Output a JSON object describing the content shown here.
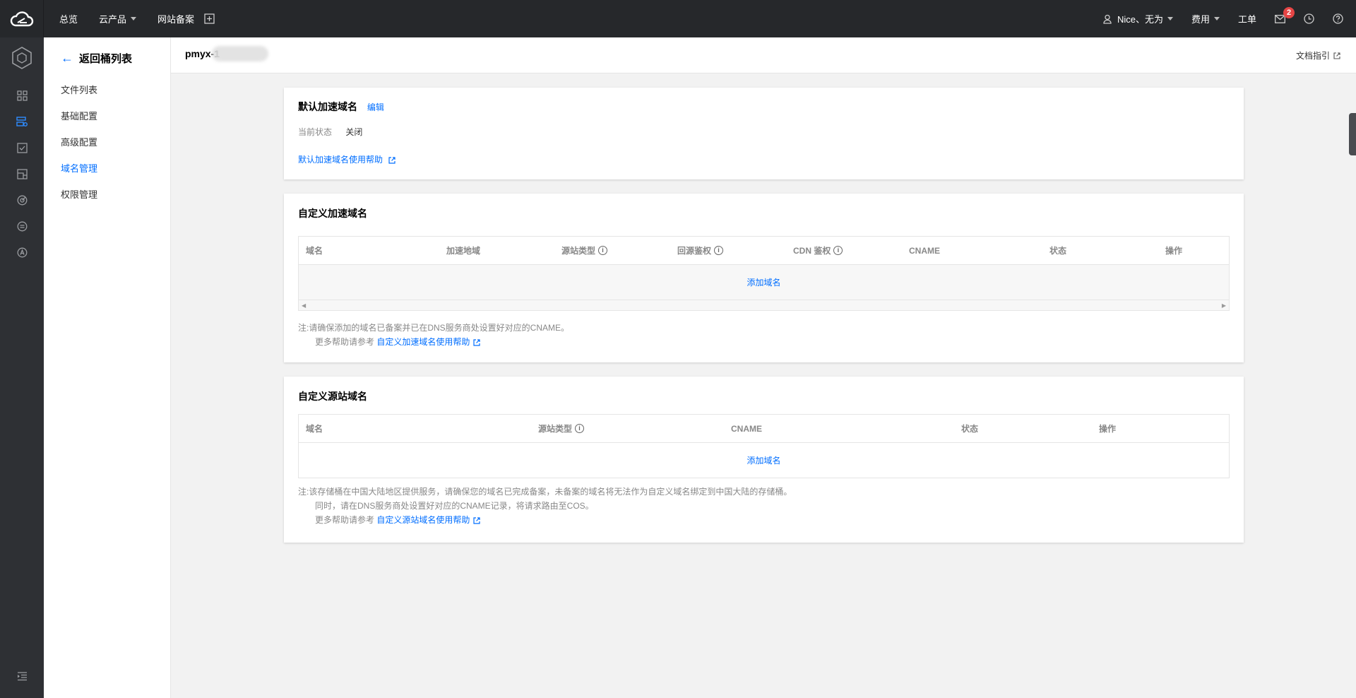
{
  "topbar": {
    "nav": [
      "总览",
      "云产品",
      "网站备案"
    ],
    "user": "Nice、无为",
    "fee": "费用",
    "ticket": "工单",
    "msg_count": "2"
  },
  "subside": {
    "back_label": "返回桶列表",
    "items": [
      "文件列表",
      "基础配置",
      "高级配置",
      "域名管理",
      "权限管理"
    ]
  },
  "header": {
    "bucket_name": "pmyx-1",
    "doc_link": "文档指引"
  },
  "default_domain": {
    "title": "默认加速域名",
    "edit": "编辑",
    "status_label": "当前状态",
    "status_value": "关闭",
    "help_link": "默认加速域名使用帮助"
  },
  "custom_cdn": {
    "title": "自定义加速域名",
    "columns": [
      "域名",
      "加速地域",
      "源站类型",
      "回源鉴权",
      "CDN 鉴权",
      "CNAME",
      "状态",
      "操作"
    ],
    "add_link": "添加域名",
    "note_prefix": "注:",
    "note_line1": "请确保添加的域名已备案并已在DNS服务商处设置好对应的CNAME。",
    "note_line2_prefix": "更多帮助请参考",
    "note_line2_link": "自定义加速域名使用帮助"
  },
  "custom_origin": {
    "title": "自定义源站域名",
    "columns": [
      "域名",
      "源站类型",
      "CNAME",
      "状态",
      "操作"
    ],
    "add_link": "添加域名",
    "note_prefix": "注:",
    "note_line1": "该存储桶在中国大陆地区提供服务，请确保您的域名已完成备案，未备案的域名将无法作为自定义域名绑定到中国大陆的存储桶。",
    "note_line2": "同时，请在DNS服务商处设置好对应的CNAME记录，将请求路由至COS。",
    "note_line3_prefix": "更多帮助请参考",
    "note_line3_link": "自定义源站域名使用帮助"
  },
  "colors": {
    "accent": "#006eff",
    "topbar": "#26282b",
    "iconbar": "#2e3034"
  }
}
